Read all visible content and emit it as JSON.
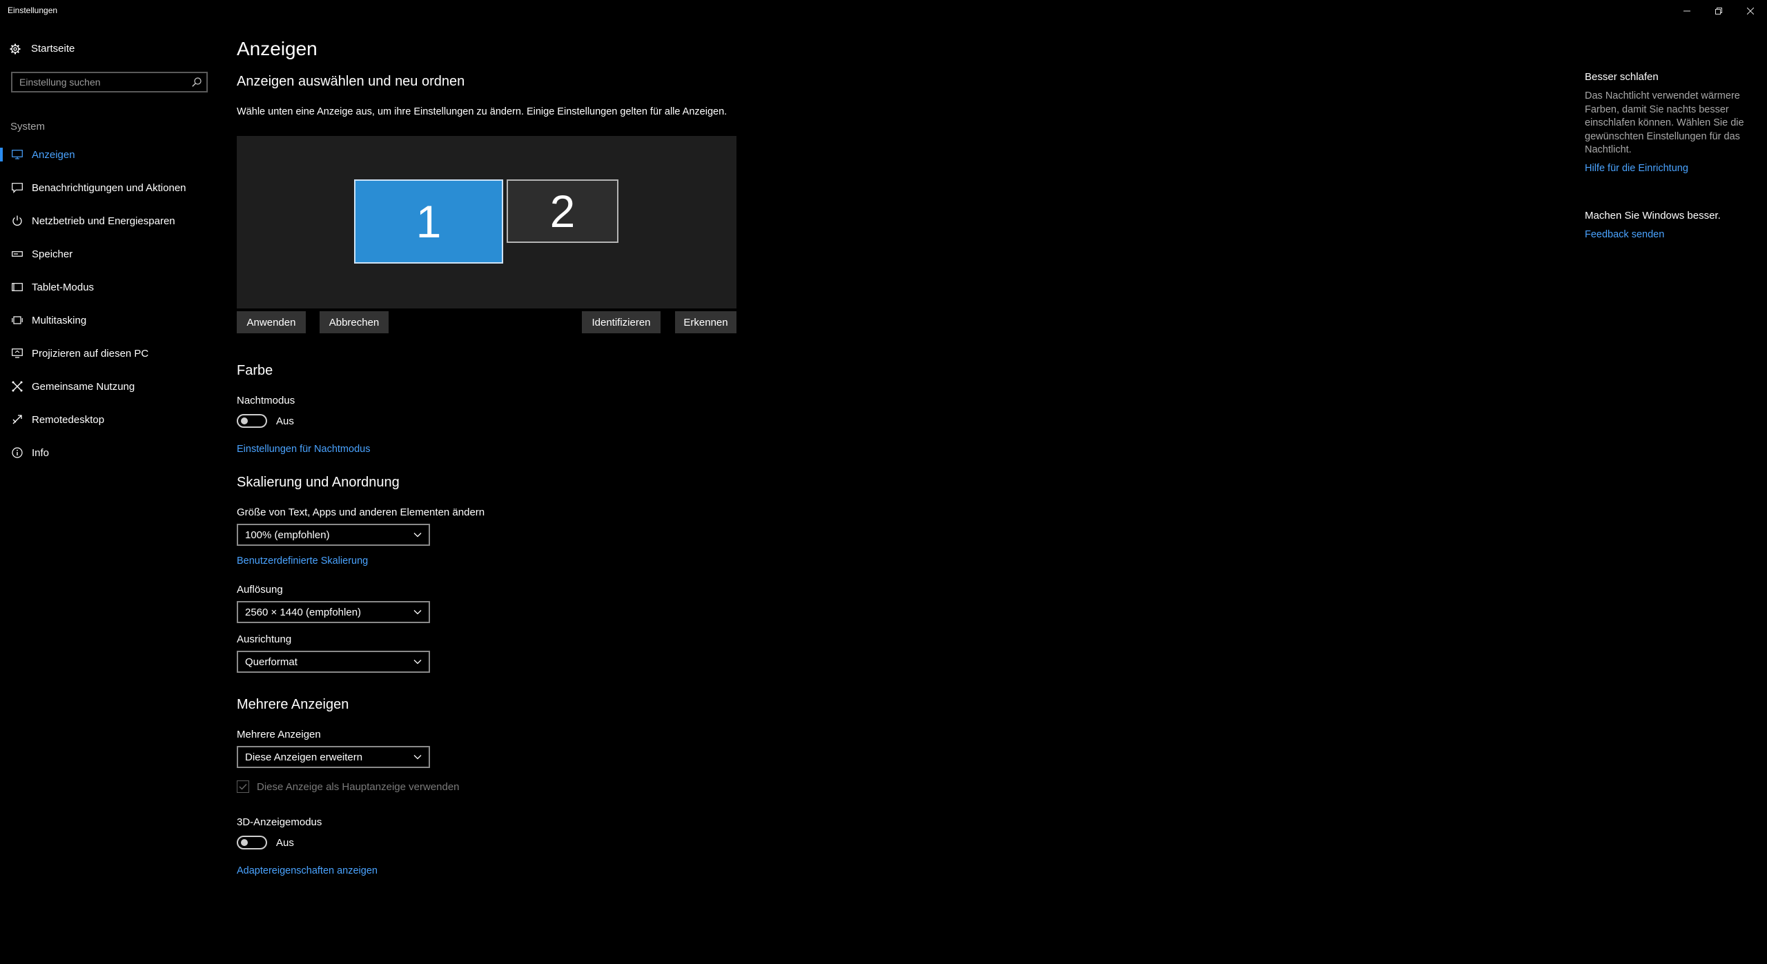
{
  "window": {
    "title": "Einstellungen",
    "controls": [
      "minimize-icon",
      "restore-icon",
      "close-icon"
    ]
  },
  "sidebar": {
    "home_label": "Startseite",
    "search_placeholder": "Einstellung suchen",
    "section": "System",
    "items": [
      {
        "label": "Anzeigen",
        "icon": "monitor-icon",
        "active": true
      },
      {
        "label": "Benachrichtigungen und Aktionen",
        "icon": "message-icon"
      },
      {
        "label": "Netzbetrieb und Energiesparen",
        "icon": "power-icon"
      },
      {
        "label": "Speicher",
        "icon": "drive-icon"
      },
      {
        "label": "Tablet-Modus",
        "icon": "tablet-icon"
      },
      {
        "label": "Multitasking",
        "icon": "multitasking-icon"
      },
      {
        "label": "Projizieren auf diesen PC",
        "icon": "project-icon"
      },
      {
        "label": "Gemeinsame Nutzung",
        "icon": "share-icon"
      },
      {
        "label": "Remotedesktop",
        "icon": "remote-icon"
      },
      {
        "label": "Info",
        "icon": "info-icon"
      }
    ]
  },
  "main": {
    "title": "Anzeigen",
    "arrange": {
      "heading": "Anzeigen auswählen und neu ordnen",
      "description": "Wähle unten eine Anzeige aus, um ihre Einstellungen zu ändern. Einige Einstellungen gelten für alle Anzeigen.",
      "monitors": [
        "1",
        "2"
      ],
      "buttons": {
        "apply": "Anwenden",
        "cancel": "Abbrechen",
        "identify": "Identifizieren",
        "detect": "Erkennen"
      }
    },
    "color": {
      "heading": "Farbe",
      "night_mode_label": "Nachtmodus",
      "night_mode_state": "Aus",
      "night_mode_link": "Einstellungen für Nachtmodus"
    },
    "scale": {
      "heading": "Skalierung und Anordnung",
      "size_label": "Größe von Text, Apps und anderen Elementen ändern",
      "size_value": "100% (empfohlen)",
      "custom_link": "Benutzerdefinierte Skalierung",
      "resolution_label": "Auflösung",
      "resolution_value": "2560 × 1440 (empfohlen)",
      "orientation_label": "Ausrichtung",
      "orientation_value": "Querformat"
    },
    "multi": {
      "heading": "Mehrere Anzeigen",
      "label": "Mehrere Anzeigen",
      "value": "Diese Anzeigen erweitern",
      "primary_checkbox": "Diese Anzeige als Hauptanzeige verwenden",
      "mode3d_label": "3D-Anzeigemodus",
      "mode3d_state": "Aus",
      "adapter_link": "Adaptereigenschaften anzeigen"
    }
  },
  "aside": {
    "sleep_title": "Besser schlafen",
    "sleep_text": "Das Nachtlicht verwendet wärmere Farben, damit Sie nachts besser einschlafen können. Wählen Sie die gewünschten Einstellungen für das Nachtlicht.",
    "sleep_link": "Hilfe für die Einrichtung",
    "feedback_title": "Machen Sie Windows besser.",
    "feedback_link": "Feedback senden"
  },
  "colors": {
    "accent": "#2a8dd4",
    "link": "#4aa3ff",
    "background": "#000000"
  }
}
